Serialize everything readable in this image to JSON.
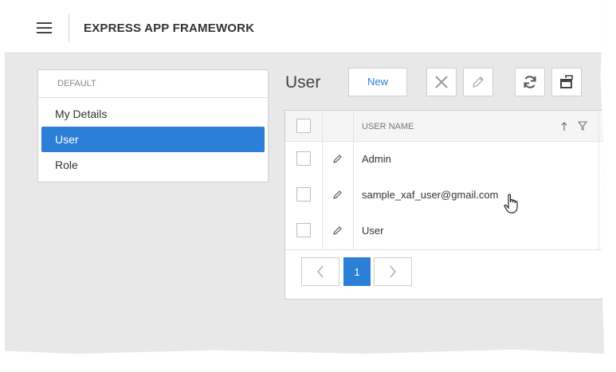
{
  "header": {
    "title": "EXPRESS APP FRAMEWORK"
  },
  "navigation": {
    "group": "DEFAULT",
    "items": [
      {
        "label": "My Details",
        "active": false
      },
      {
        "label": "User",
        "active": true
      },
      {
        "label": "Role",
        "active": false
      }
    ]
  },
  "view": {
    "title": "User",
    "toolbar": {
      "new_label": "New"
    }
  },
  "grid": {
    "column": "USER NAME",
    "rows": [
      {
        "user_name": "Admin"
      },
      {
        "user_name": "sample_xaf_user@gmail.com"
      },
      {
        "user_name": "User"
      }
    ],
    "pager": {
      "current_page": "1"
    }
  },
  "colors": {
    "accent": "#2b7fd6",
    "background": "#e8e8e8"
  }
}
